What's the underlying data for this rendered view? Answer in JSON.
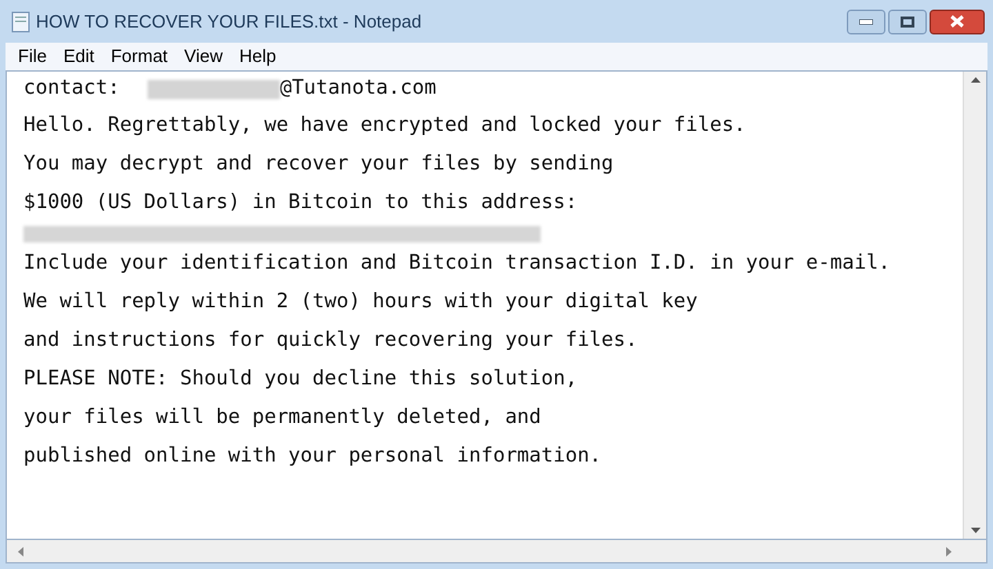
{
  "window": {
    "title": "HOW TO RECOVER YOUR FILES.txt - Notepad"
  },
  "menu": [
    "File",
    "Edit",
    "Format",
    "View",
    "Help"
  ],
  "lines": [
    {
      "kind": "contact",
      "label": "contact:",
      "text": "@Tutanota.com"
    },
    {
      "kind": "text",
      "text": "Hello. Regrettably, we have encrypted and locked your files."
    },
    {
      "kind": "text",
      "text": "You may decrypt and recover your files by sending"
    },
    {
      "kind": "text",
      "text": "$1000 (US Dollars) in Bitcoin to this address:"
    },
    {
      "kind": "redacted"
    },
    {
      "kind": "text",
      "text": "Include your identification and Bitcoin transaction I.D. in your e-mail."
    },
    {
      "kind": "text",
      "text": "We will reply within 2 (two) hours with your digital key"
    },
    {
      "kind": "text",
      "text": "and instructions for quickly recovering your files."
    },
    {
      "kind": "text",
      "text": "PLEASE NOTE: Should you decline this solution,"
    },
    {
      "kind": "text",
      "text": "your files will be permanently deleted, and"
    },
    {
      "kind": "text",
      "text": "published online with your personal information."
    }
  ]
}
